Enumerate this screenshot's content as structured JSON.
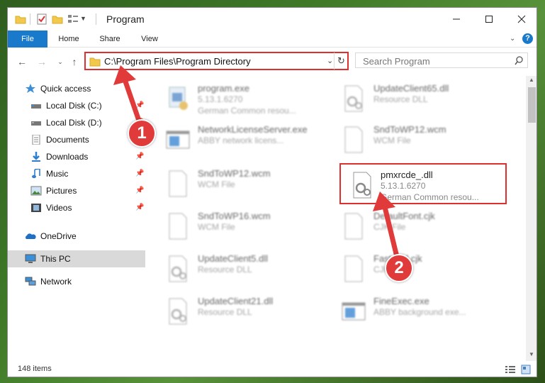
{
  "window": {
    "title": "Program"
  },
  "ribbon": {
    "tabs": [
      "File",
      "Home",
      "Share",
      "View"
    ]
  },
  "address": {
    "path": "C:\\Program Files\\Program Directory"
  },
  "search": {
    "placeholder": "Search Program"
  },
  "nav": {
    "items": [
      {
        "label": "Quick access",
        "icon": "star-icon",
        "pinned": false
      },
      {
        "label": "Local Disk (C:)",
        "icon": "drive-icon",
        "pinned": true
      },
      {
        "label": "Local Disk (D:)",
        "icon": "drive-icon",
        "pinned": true
      },
      {
        "label": "Documents",
        "icon": "documents-icon",
        "pinned": true
      },
      {
        "label": "Downloads",
        "icon": "downloads-icon",
        "pinned": true
      },
      {
        "label": "Music",
        "icon": "music-icon",
        "pinned": true
      },
      {
        "label": "Pictures",
        "icon": "pictures-icon",
        "pinned": true
      },
      {
        "label": "Videos",
        "icon": "videos-icon",
        "pinned": true
      },
      {
        "label": "OneDrive",
        "icon": "onedrive-icon",
        "pinned": false
      },
      {
        "label": "This PC",
        "icon": "pc-icon",
        "pinned": false,
        "selected": true
      },
      {
        "label": "Network",
        "icon": "network-icon",
        "pinned": false
      }
    ]
  },
  "files": [
    {
      "name": "program.exe",
      "line2": "5.13.1.6270",
      "line3": "German Common resou...",
      "icon": "exe-icon"
    },
    {
      "name": "UpdateClient65.dll",
      "line2": "Resource DLL",
      "line3": "",
      "icon": "dll-icon"
    },
    {
      "name": "NetworkLicenseServer.exe",
      "line2": "ABBY network licens...",
      "line3": "",
      "icon": "window-icon"
    },
    {
      "name": "SndToWP12.wcm",
      "line2": "WCM File",
      "line3": "",
      "icon": "blank-file-icon"
    },
    {
      "name": "SndToWP12.wcm",
      "line2": "WCM File",
      "line3": "",
      "icon": "blank-file-icon"
    },
    {
      "name": "pmxrcde_.dll",
      "line2": "5.13.1.6270",
      "line3": "German Common resou...",
      "icon": "dll-icon",
      "highlighted": true
    },
    {
      "name": "SndToWP16.wcm",
      "line2": "WCM File",
      "line3": "",
      "icon": "blank-file-icon"
    },
    {
      "name": "DefaultFont.cjk",
      "line2": "CJK File",
      "line3": "",
      "icon": "blank-file-icon"
    },
    {
      "name": "UpdateClient5.dll",
      "line2": "Resource DLL",
      "line3": "",
      "icon": "dll-icon"
    },
    {
      "name": "Fastcool.cjk",
      "line2": "CJK File",
      "line3": "",
      "icon": "blank-file-icon"
    },
    {
      "name": "UpdateClient21.dll",
      "line2": "Resource DLL",
      "line3": "",
      "icon": "dll-icon"
    },
    {
      "name": "FineExec.exe",
      "line2": "ABBY background exe...",
      "line3": "",
      "icon": "window-icon"
    }
  ],
  "status": {
    "item_count": "148 items"
  },
  "callouts": {
    "first": "1",
    "second": "2"
  },
  "colors": {
    "accent": "#1979ca",
    "highlight": "#e02f2f",
    "callout": "#e03a3a"
  }
}
